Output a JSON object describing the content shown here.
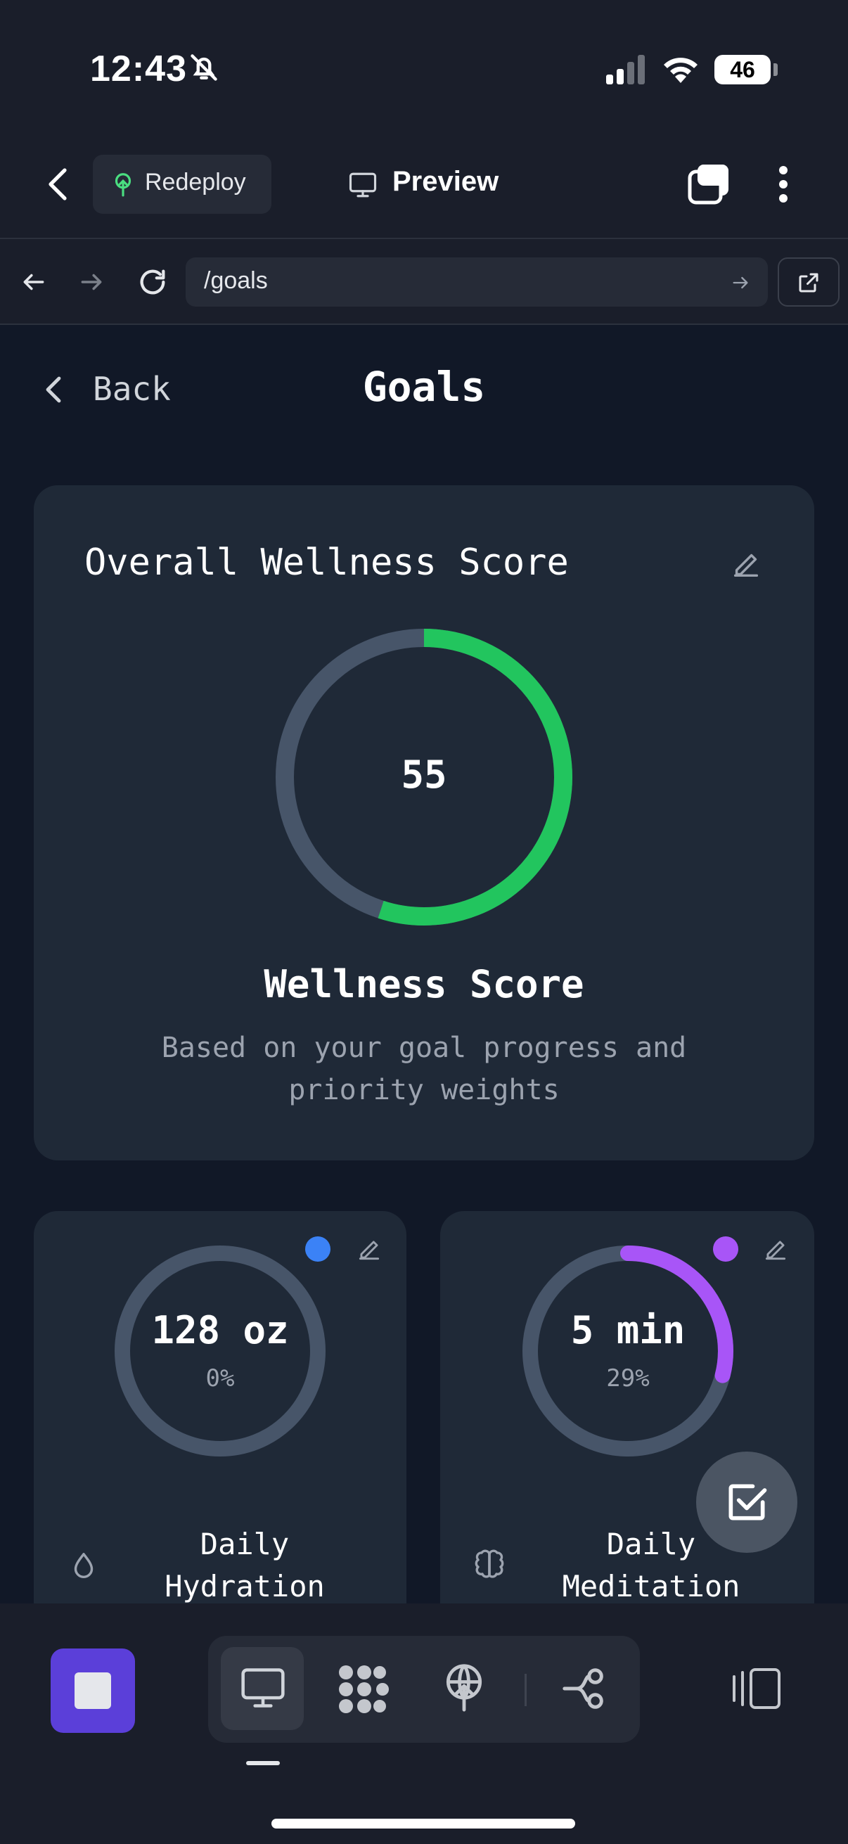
{
  "status_bar": {
    "time": "12:43",
    "battery": "46"
  },
  "toolbar": {
    "redeploy_label": "Redeploy",
    "preview_label": "Preview"
  },
  "url_bar": {
    "path": "/goals"
  },
  "page": {
    "back_label": "Back",
    "title": "Goals"
  },
  "wellness": {
    "card_title": "Overall Wellness Score",
    "score": "55",
    "score_fraction": 0.55,
    "label": "Wellness Score",
    "description": "Based on your goal progress and priority weights",
    "ring_color": "#22c55e"
  },
  "goals": [
    {
      "value": "128 oz",
      "percent": "0%",
      "progress": 0.0,
      "name_line1": "Daily",
      "name_line2": "Hydration",
      "dot_color": "#3b82f6",
      "icon": "droplet-icon"
    },
    {
      "value": "5 min",
      "percent": "29%",
      "progress": 0.29,
      "name_line1": "Daily",
      "name_line2": "Meditation",
      "dot_color": "#a855f7",
      "icon": "brain-icon"
    }
  ],
  "colors": {
    "track": "#475569",
    "accent_purple": "#5b3fd9"
  }
}
